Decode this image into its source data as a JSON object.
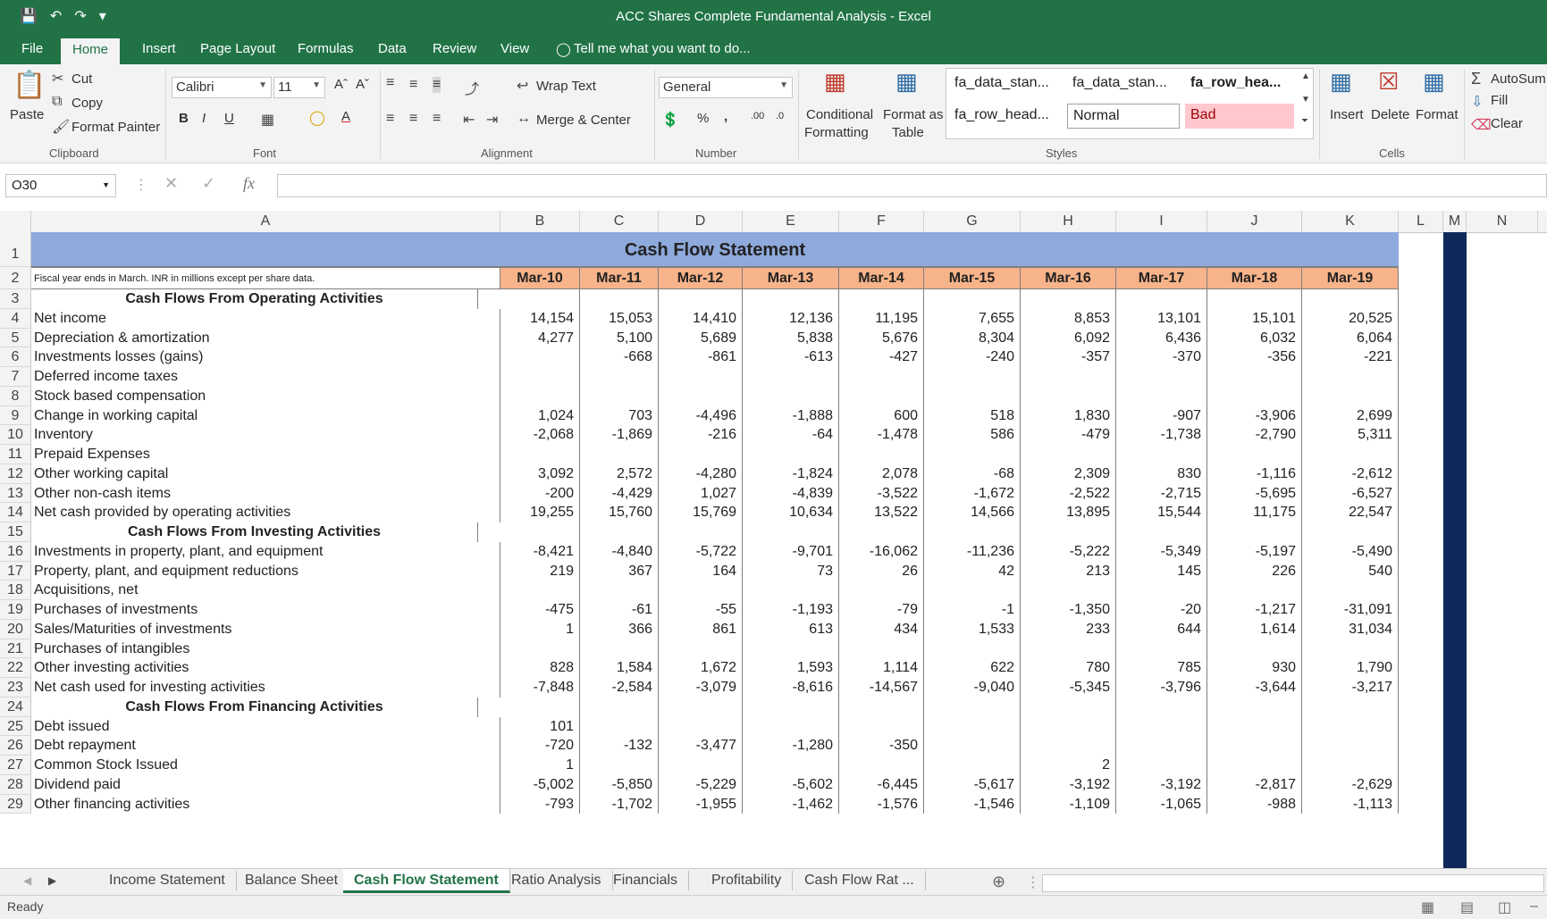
{
  "window": {
    "title": "ACC Shares Complete Fundamental Analysis - Excel"
  },
  "ribbon_tabs": [
    "File",
    "Home",
    "Insert",
    "Page Layout",
    "Formulas",
    "Data",
    "Review",
    "View"
  ],
  "active_ribbon_tab": "Home",
  "tell_me": "Tell me what you want to do...",
  "clipboard": {
    "paste": "Paste",
    "cut": "Cut",
    "copy": "Copy",
    "format_painter": "Format Painter",
    "label": "Clipboard"
  },
  "font": {
    "name": "Calibri",
    "size": "11",
    "label": "Font"
  },
  "alignment": {
    "wrap_text": "Wrap Text",
    "merge_center": "Merge & Center",
    "label": "Alignment"
  },
  "number": {
    "format": "General",
    "label": "Number"
  },
  "styles": {
    "conditional_1": "Conditional",
    "conditional_2": "Formatting",
    "format_as_1": "Format as",
    "format_as_2": "Table",
    "cells": [
      "fa_data_stan...",
      "fa_data_stan...",
      "fa_row_hea...",
      "fa_row_head...",
      "Normal",
      "Bad"
    ],
    "label": "Styles"
  },
  "cells_group": {
    "insert": "Insert",
    "delete": "Delete",
    "format": "Format",
    "label": "Cells"
  },
  "editing": {
    "autosum": "AutoSum",
    "fill": "Fill",
    "clear": "Clear"
  },
  "name_box": "O30",
  "columns": [
    "A",
    "B",
    "C",
    "D",
    "E",
    "F",
    "G",
    "H",
    "I",
    "J",
    "K",
    "L",
    "M",
    "N"
  ],
  "sheet": {
    "title": "Cash Flow Statement",
    "subtitle": "Fiscal year ends in March. INR in millions except per share data.",
    "periods": [
      "Mar-10",
      "Mar-11",
      "Mar-12",
      "Mar-13",
      "Mar-14",
      "Mar-15",
      "Mar-16",
      "Mar-17",
      "Mar-18",
      "Mar-19"
    ],
    "rows": [
      {
        "n": "3",
        "label": "Cash Flows From Operating Activities",
        "section": true,
        "values": []
      },
      {
        "n": "4",
        "label": "Net income",
        "values": [
          "14,154",
          "15,053",
          "14,410",
          "12,136",
          "11,195",
          "7,655",
          "8,853",
          "13,101",
          "15,101",
          "20,525"
        ]
      },
      {
        "n": "5",
        "label": "Depreciation & amortization",
        "values": [
          "4,277",
          "5,100",
          "5,689",
          "5,838",
          "5,676",
          "8,304",
          "6,092",
          "6,436",
          "6,032",
          "6,064"
        ]
      },
      {
        "n": "6",
        "label": "Investments losses (gains)",
        "values": [
          "",
          "-668",
          "-861",
          "-613",
          "-427",
          "-240",
          "-357",
          "-370",
          "-356",
          "-221"
        ]
      },
      {
        "n": "7",
        "label": "Deferred income taxes",
        "values": []
      },
      {
        "n": "8",
        "label": "Stock based compensation",
        "values": []
      },
      {
        "n": "9",
        "label": "Change in working capital",
        "values": [
          "1,024",
          "703",
          "-4,496",
          "-1,888",
          "600",
          "518",
          "1,830",
          "-907",
          "-3,906",
          "2,699"
        ]
      },
      {
        "n": "10",
        "label": "Inventory",
        "values": [
          "-2,068",
          "-1,869",
          "-216",
          "-64",
          "-1,478",
          "586",
          "-479",
          "-1,738",
          "-2,790",
          "5,311"
        ]
      },
      {
        "n": "11",
        "label": "Prepaid Expenses",
        "values": []
      },
      {
        "n": "12",
        "label": "Other working capital",
        "values": [
          "3,092",
          "2,572",
          "-4,280",
          "-1,824",
          "2,078",
          "-68",
          "2,309",
          "830",
          "-1,116",
          "-2,612"
        ]
      },
      {
        "n": "13",
        "label": "Other non-cash items",
        "values": [
          "-200",
          "-4,429",
          "1,027",
          "-4,839",
          "-3,522",
          "-1,672",
          "-2,522",
          "-2,715",
          "-5,695",
          "-6,527"
        ]
      },
      {
        "n": "14",
        "label": "Net cash provided by operating activities",
        "values": [
          "19,255",
          "15,760",
          "15,769",
          "10,634",
          "13,522",
          "14,566",
          "13,895",
          "15,544",
          "11,175",
          "22,547"
        ]
      },
      {
        "n": "15",
        "label": "Cash Flows From Investing Activities",
        "section": true,
        "values": []
      },
      {
        "n": "16",
        "label": "Investments in property, plant, and equipment",
        "values": [
          "-8,421",
          "-4,840",
          "-5,722",
          "-9,701",
          "-16,062",
          "-11,236",
          "-5,222",
          "-5,349",
          "-5,197",
          "-5,490"
        ]
      },
      {
        "n": "17",
        "label": "Property, plant, and equipment reductions",
        "values": [
          "219",
          "367",
          "164",
          "73",
          "26",
          "42",
          "213",
          "145",
          "226",
          "540"
        ]
      },
      {
        "n": "18",
        "label": "Acquisitions, net",
        "values": []
      },
      {
        "n": "19",
        "label": "Purchases of investments",
        "values": [
          "-475",
          "-61",
          "-55",
          "-1,193",
          "-79",
          "-1",
          "-1,350",
          "-20",
          "-1,217",
          "-31,091"
        ]
      },
      {
        "n": "20",
        "label": "Sales/Maturities of investments",
        "values": [
          "1",
          "366",
          "861",
          "613",
          "434",
          "1,533",
          "233",
          "644",
          "1,614",
          "31,034"
        ]
      },
      {
        "n": "21",
        "label": "Purchases of intangibles",
        "values": []
      },
      {
        "n": "22",
        "label": "Other investing activities",
        "values": [
          "828",
          "1,584",
          "1,672",
          "1,593",
          "1,114",
          "622",
          "780",
          "785",
          "930",
          "1,790"
        ]
      },
      {
        "n": "23",
        "label": "Net cash used for investing activities",
        "values": [
          "-7,848",
          "-2,584",
          "-3,079",
          "-8,616",
          "-14,567",
          "-9,040",
          "-5,345",
          "-3,796",
          "-3,644",
          "-3,217"
        ]
      },
      {
        "n": "24",
        "label": "Cash Flows From Financing Activities",
        "section": true,
        "values": []
      },
      {
        "n": "25",
        "label": "Debt issued",
        "values": [
          "101",
          "",
          "",
          "",
          "",
          "",
          "",
          "",
          "",
          ""
        ]
      },
      {
        "n": "26",
        "label": "Debt repayment",
        "values": [
          "-720",
          "-132",
          "-3,477",
          "-1,280",
          "-350",
          "",
          "",
          "",
          "",
          ""
        ]
      },
      {
        "n": "27",
        "label": "Common Stock Issued",
        "values": [
          "1",
          "",
          "",
          "",
          "",
          "",
          "2",
          "",
          "",
          ""
        ]
      },
      {
        "n": "28",
        "label": "Dividend paid",
        "values": [
          "-5,002",
          "-5,850",
          "-5,229",
          "-5,602",
          "-6,445",
          "-5,617",
          "-3,192",
          "-3,192",
          "-2,817",
          "-2,629"
        ]
      },
      {
        "n": "29",
        "label": "Other financing activities",
        "values": [
          "-793",
          "-1,702",
          "-1,955",
          "-1,462",
          "-1,576",
          "-1,546",
          "-1,109",
          "-1,065",
          "-988",
          "-1,113"
        ]
      }
    ]
  },
  "sheet_tabs": [
    "Income Statement",
    "Balance Sheet",
    "Cash Flow Statement",
    "Ratio Analysis",
    "Financials",
    "Profitability",
    "Cash Flow Rat ..."
  ],
  "active_sheet_tab": "Cash Flow Statement",
  "status": "Ready",
  "colors": {
    "excel_green": "#217346",
    "title_band": "#8ea9db",
    "period_header": "#f7b389",
    "navy_column": "#0f2a5a"
  }
}
